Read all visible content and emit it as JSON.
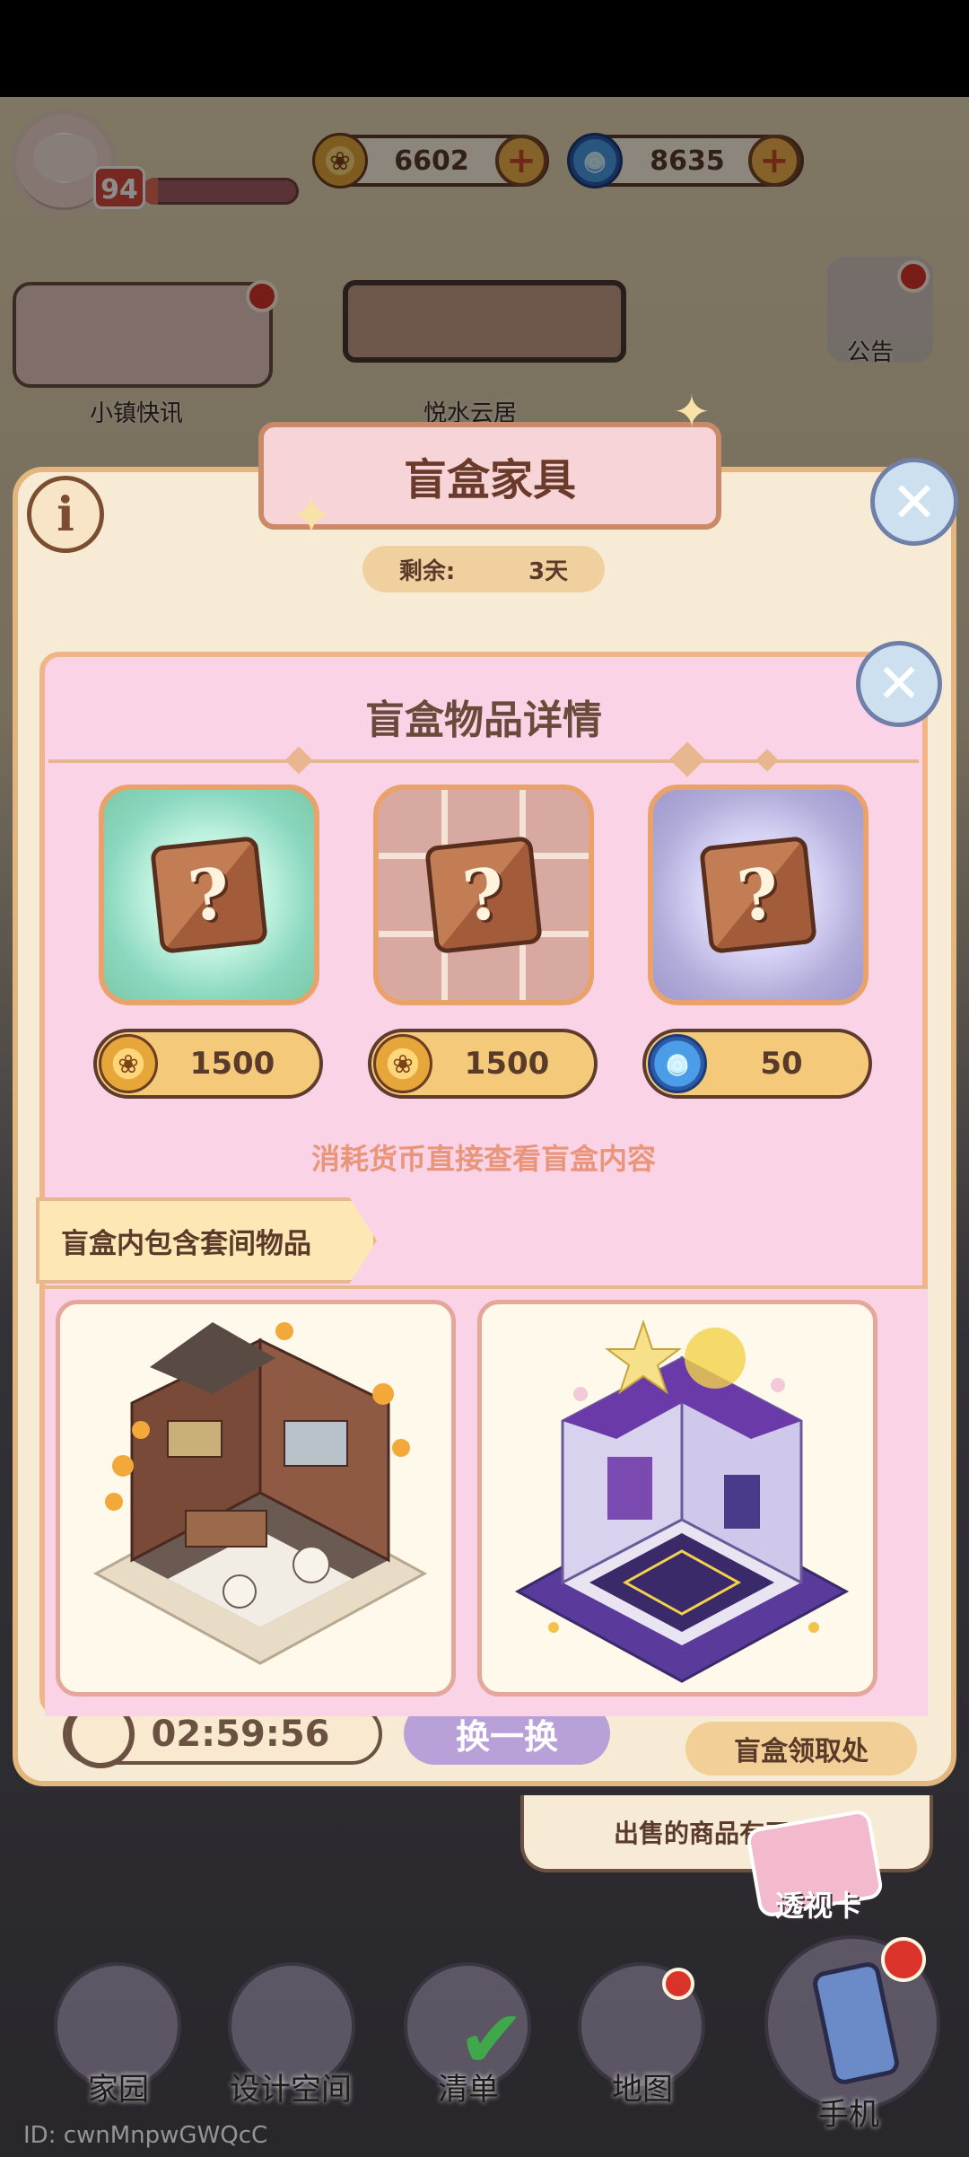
{
  "hud": {
    "level": "94",
    "xp_progress": 0.1,
    "gold": "6602",
    "gems": "8635",
    "plus": "+"
  },
  "side": {
    "news_label": "小镇快讯",
    "notice_label": "公告",
    "area_label": "悦水云居"
  },
  "panel": {
    "title": "盲盒家具",
    "remain_label": "剩余:",
    "remain_value": "3天",
    "info": "i",
    "close": "✕",
    "timer": "02:59:56",
    "swap_label": "换一换",
    "pickup_label": "盲盒领取处",
    "sale_note": "出售的商品有买家了",
    "card_label": "透视卡"
  },
  "modal": {
    "title": "盲盒物品详情",
    "close": "✕",
    "boxes": [
      {
        "price": "1500",
        "currency": "gold-coin"
      },
      {
        "price": "1500",
        "currency": "gold-coin"
      },
      {
        "price": "50",
        "currency": "gem"
      }
    ],
    "question_mark": "?",
    "hint": "消耗货币直接查看盲盒内容",
    "section_tag": "盲盒内包含套间物品"
  },
  "nav": {
    "home": "家园",
    "design": "设计空间",
    "list": "清单",
    "map": "地图",
    "phone": "手机"
  },
  "uid": "ID: cwnMnpwGWQcC",
  "colors": {
    "panel_bg": "#f7ebd5",
    "modal_bg": "#fbd3e6",
    "accent_orange": "#f4c97a",
    "hint": "#e8957a"
  }
}
